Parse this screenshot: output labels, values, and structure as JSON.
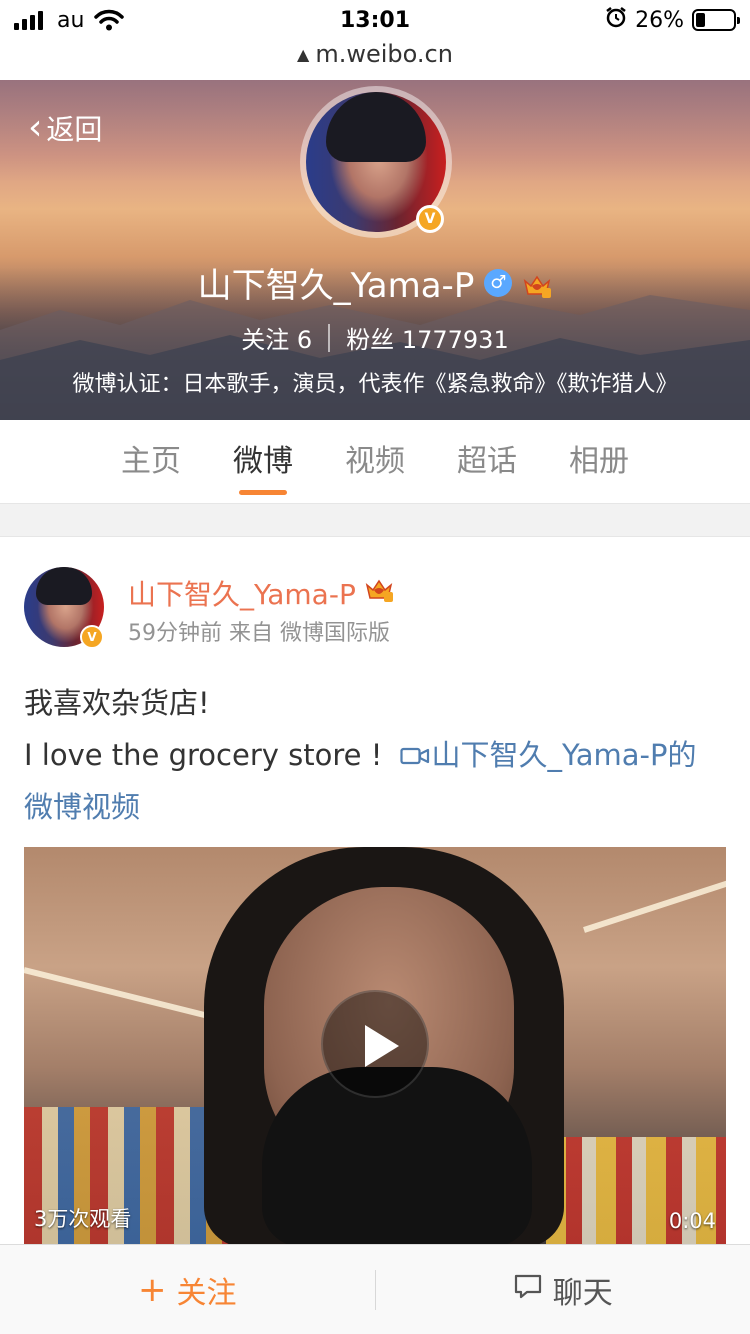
{
  "status_bar": {
    "carrier": "au",
    "time": "13:01",
    "battery": "26%",
    "battery_level": 0.26
  },
  "url_bar": {
    "url": "m.weibo.cn"
  },
  "header": {
    "back_label": "返回",
    "name": "山下智久_Yama-P",
    "following_label": "关注",
    "following_count": "6",
    "followers_label": "粉丝",
    "followers_count": "1777931",
    "verification": "微博认证：日本歌手，演员，代表作《紧急救命》《欺诈猎人》",
    "badge_v": "V",
    "gender_symbol": "♂"
  },
  "tabs": [
    {
      "label": "主页",
      "active": false
    },
    {
      "label": "微博",
      "active": true
    },
    {
      "label": "视频",
      "active": false
    },
    {
      "label": "超话",
      "active": false
    },
    {
      "label": "相册",
      "active": false
    }
  ],
  "post": {
    "author": "山下智久_Yama-P",
    "meta": "59分钟前 来自 微博国际版",
    "text_line1": "我喜欢杂货店!",
    "text_line2": "I love the grocery store ! ",
    "video_link": "山下智久_Yama-P的微博视频",
    "video": {
      "views": "3万次观看",
      "duration": "0:04"
    },
    "badge_v": "V"
  },
  "bottom_bar": {
    "follow_label": "关注",
    "chat_label": "聊天"
  },
  "colors": {
    "accent_orange": "#f78534",
    "author_orange": "#eb7350",
    "link_blue": "#507daf",
    "verified_gold": "#f5a623"
  }
}
